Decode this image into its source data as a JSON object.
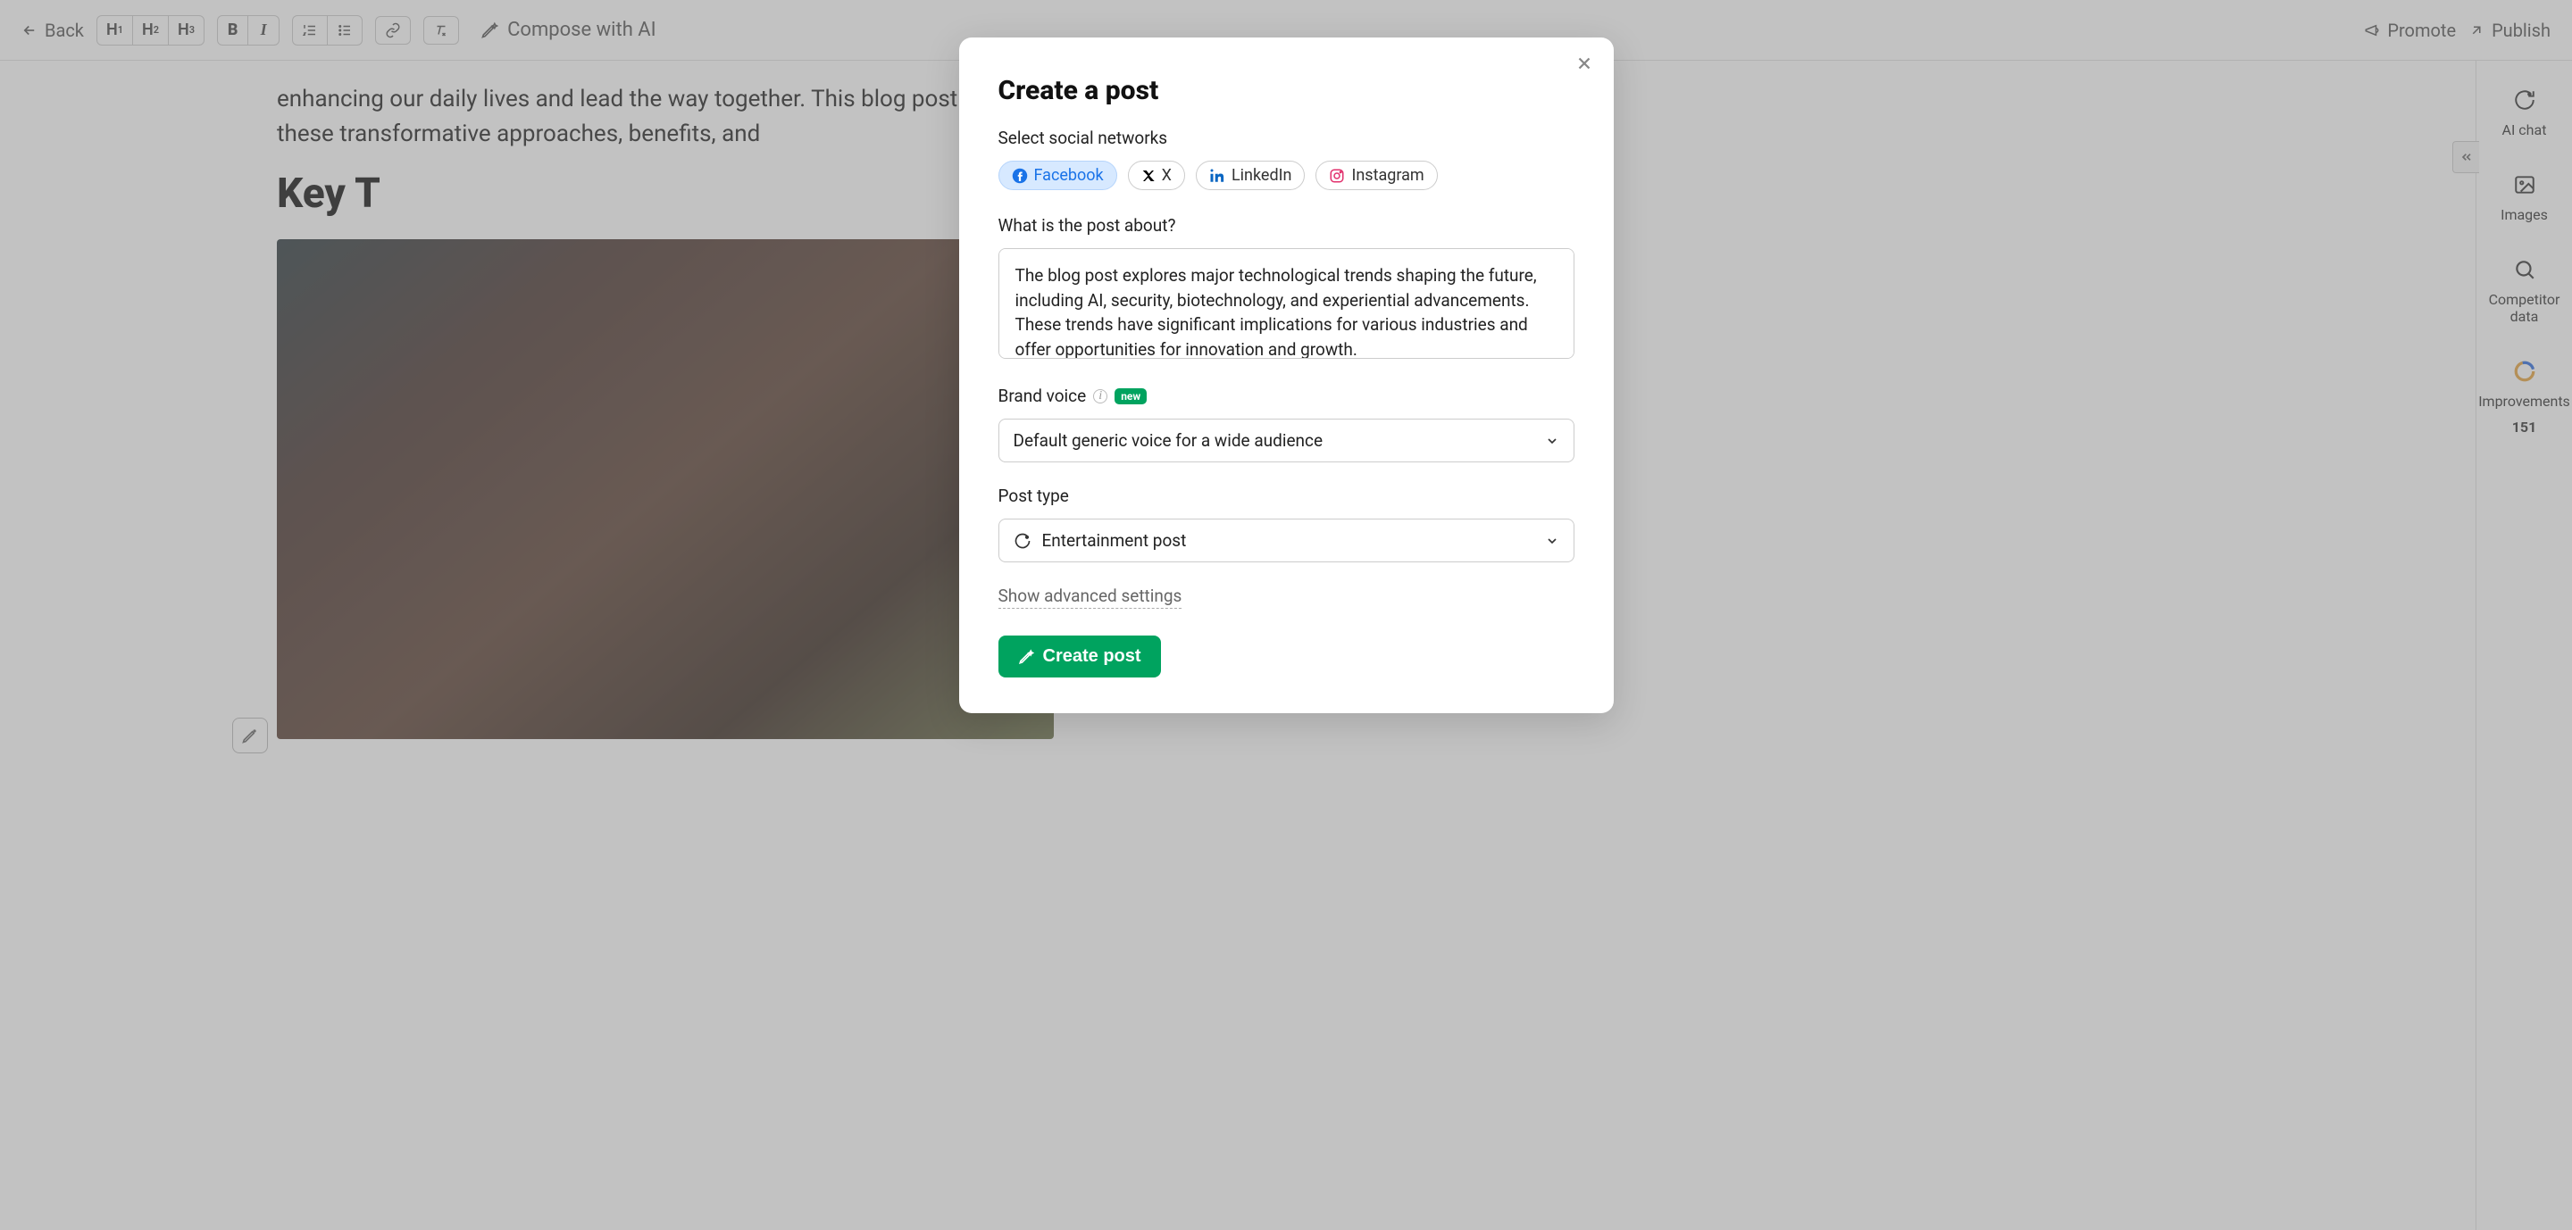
{
  "toolbar": {
    "back": "Back",
    "compose": "Compose with AI",
    "promote": "Promote",
    "publish": "Publish",
    "headings": [
      "H1",
      "H2",
      "H3"
    ]
  },
  "article": {
    "text_fragment": "enhancing our daily lives and lead the way together. This blog post explores these transformative approaches, benefits, and",
    "heading": "Key T"
  },
  "sidebar": {
    "ai_chat": "AI chat",
    "images": "Images",
    "competitor": "Competitor data",
    "improvements_label": "Improvements",
    "improvements_count": "151"
  },
  "modal": {
    "title": "Create a post",
    "select_networks_label": "Select social networks",
    "networks": {
      "facebook": "Facebook",
      "x": "X",
      "linkedin": "LinkedIn",
      "instagram": "Instagram"
    },
    "about_label": "What is the post about?",
    "about_value": "The blog post explores major technological trends shaping the future, including AI, security, biotechnology, and experiential advancements. These trends have significant implications for various industries and offer opportunities for innovation and growth.",
    "brand_voice_label": "Brand voice",
    "brand_voice_badge": "new",
    "brand_voice_value": "Default generic voice for a wide audience",
    "post_type_label": "Post type",
    "post_type_value": "Entertainment post",
    "show_advanced": "Show advanced settings",
    "create_button": "Create post"
  }
}
